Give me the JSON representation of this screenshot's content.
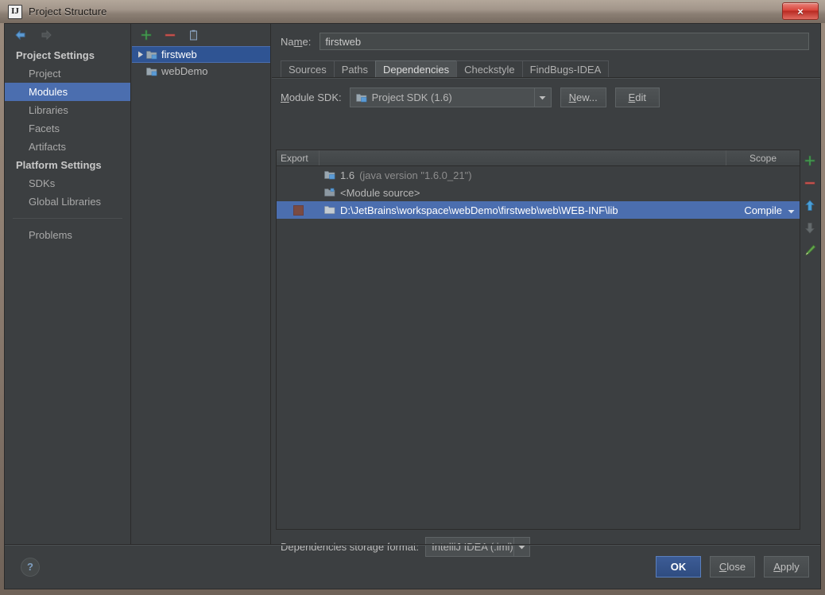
{
  "window": {
    "title": "Project Structure",
    "app_icon": "intellij-idea-icon",
    "close_label": "×"
  },
  "nav": {
    "back_icon": "arrow-left-icon",
    "forward_icon": "arrow-right-icon"
  },
  "sidebar": {
    "groups": [
      {
        "label": "Project Settings",
        "items": [
          {
            "label": "Project",
            "selected": false
          },
          {
            "label": "Modules",
            "selected": true
          },
          {
            "label": "Libraries",
            "selected": false
          },
          {
            "label": "Facets",
            "selected": false
          },
          {
            "label": "Artifacts",
            "selected": false
          }
        ]
      },
      {
        "label": "Platform Settings",
        "items": [
          {
            "label": "SDKs",
            "selected": false
          },
          {
            "label": "Global Libraries",
            "selected": false
          }
        ]
      }
    ],
    "problems": {
      "label": "Problems",
      "selected": false
    }
  },
  "tree": {
    "toolbar": [
      {
        "name": "add-module-button",
        "icon": "plus-icon",
        "color": "#499c54"
      },
      {
        "name": "remove-module-button",
        "icon": "minus-icon",
        "color": "#c75450"
      },
      {
        "name": "copy-module-button",
        "icon": "copy-icon",
        "color": "#7a9bc4"
      }
    ],
    "nodes": [
      {
        "label": "firstweb",
        "selected": true,
        "expandable": true
      },
      {
        "label": "webDemo",
        "selected": false,
        "expandable": false
      }
    ]
  },
  "module": {
    "name_label": "Name:",
    "name_value": "firstweb",
    "tabs": [
      {
        "label": "Sources",
        "active": false
      },
      {
        "label": "Paths",
        "active": false
      },
      {
        "label": "Dependencies",
        "active": true
      },
      {
        "label": "Checkstyle",
        "active": false
      },
      {
        "label": "FindBugs-IDEA",
        "active": false
      }
    ],
    "sdk_label": "Module SDK:",
    "sdk_value": "Project SDK (1.6)",
    "new_button": "New...",
    "edit_button": "Edit"
  },
  "dependencies_table": {
    "columns": {
      "export": "Export",
      "scope": "Scope"
    },
    "rows": [
      {
        "export_checked": false,
        "export_visible": false,
        "icon": "jdk-icon",
        "name": "1.6",
        "name_suffix": "(java version \"1.6.0_21\")",
        "scope": "",
        "has_scope_arrow": false,
        "selected": false
      },
      {
        "export_checked": false,
        "export_visible": false,
        "icon": "module-source-icon",
        "name": "<Module source>",
        "name_suffix": "",
        "scope": "",
        "has_scope_arrow": false,
        "selected": false
      },
      {
        "export_checked": true,
        "export_visible": true,
        "icon": "folder-icon",
        "name": "D:\\JetBrains\\workspace\\webDemo\\firstweb\\web\\WEB-INF\\lib",
        "name_suffix": "",
        "scope": "Compile",
        "has_scope_arrow": true,
        "selected": true
      }
    ],
    "side_toolbar": [
      {
        "name": "add-dependency-button",
        "icon": "plus-icon",
        "color": "#499c54"
      },
      {
        "name": "remove-dependency-button",
        "icon": "minus-icon",
        "color": "#c75450"
      },
      {
        "name": "move-up-button",
        "icon": "arrow-up-icon",
        "color": "#4a9fd8"
      },
      {
        "name": "move-down-button",
        "icon": "arrow-down-icon",
        "color": "#6b6b6b"
      },
      {
        "name": "edit-dependency-button",
        "icon": "pencil-icon",
        "color": "#62a34b"
      }
    ]
  },
  "storage": {
    "label": "Dependencies storage format:",
    "value": "IntelliJ IDEA (.iml)"
  },
  "footer": {
    "help_label": "?",
    "ok_label": "OK",
    "close_label": "Close",
    "apply_label": "Apply"
  },
  "colors": {
    "selection_blue": "#4b6eaf",
    "tree_selection": "#2f5493",
    "panel_bg": "#3c3f41",
    "accent_green": "#499c54",
    "accent_red": "#c75450",
    "titlebar": "#a2958a"
  }
}
